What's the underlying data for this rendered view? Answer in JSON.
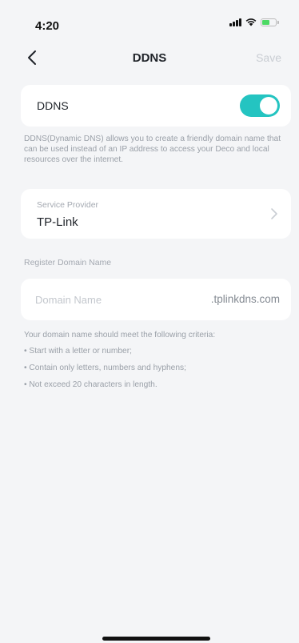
{
  "status_bar": {
    "time": "4:20",
    "icons": [
      "signal-icon",
      "wifi-icon",
      "battery-icon"
    ]
  },
  "nav": {
    "back_icon": "chevron-left-icon",
    "title": "DDNS",
    "save_label": "Save"
  },
  "ddns": {
    "label": "DDNS",
    "enabled": true,
    "description": "DDNS(Dynamic DNS) allows you to create a friendly domain name that can be used instead of an IP address to access your Deco and local resources over the internet."
  },
  "service_provider": {
    "caption": "Service Provider",
    "value": "TP-Link",
    "icon": "chevron-right-icon"
  },
  "register": {
    "section_label": "Register Domain Name",
    "domain_placeholder": "Domain Name",
    "domain_value": "",
    "domain_suffix": ".tplinkdns.com"
  },
  "criteria": {
    "title": "Your domain name should meet the following criteria:",
    "items": [
      "Start with a letter or number;",
      "Contain only letters, numbers and hyphens;",
      "Not exceed 20 characters in length."
    ]
  },
  "colors": {
    "accent": "#24c4c1",
    "background": "#f4f5f7",
    "card": "#ffffff",
    "muted_text": "#9aa0a8"
  }
}
